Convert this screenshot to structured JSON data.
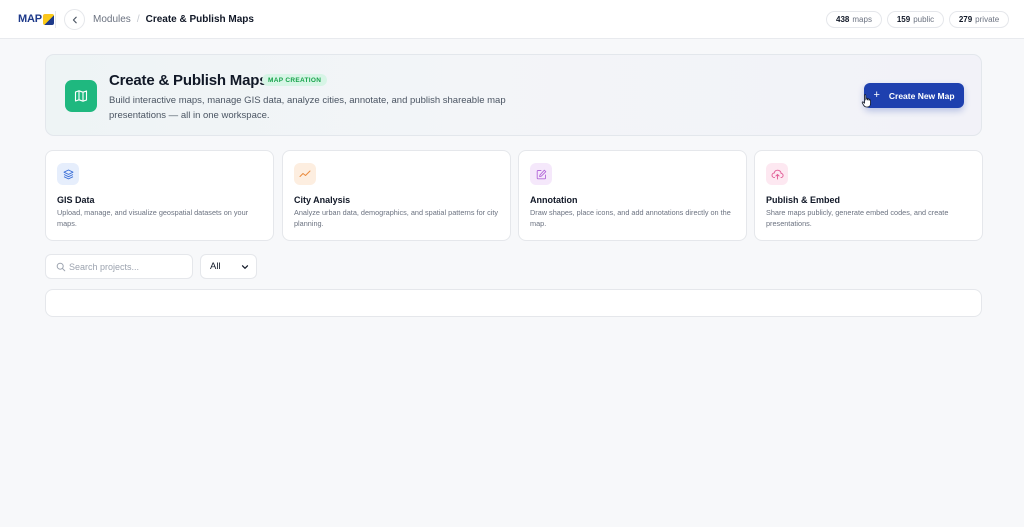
{
  "header": {
    "logo_text": "MAP",
    "breadcrumb": {
      "parent": "Modules",
      "separator": "/",
      "current": "Create & Publish Maps"
    },
    "stats": [
      {
        "value": "438",
        "label": "maps"
      },
      {
        "value": "159",
        "label": "public"
      },
      {
        "value": "279",
        "label": "private"
      }
    ]
  },
  "hero": {
    "title": "Create & Publish Maps",
    "badge": "MAP CREATION",
    "description": "Build interactive maps, manage GIS data, analyze cities, annotate, and publish shareable map presentations — all in one workspace.",
    "create_button": {
      "icon": "+",
      "label": "Create New Map"
    }
  },
  "features": [
    {
      "icon": "layers-icon",
      "title": "GIS Data",
      "description": "Upload, manage, and visualize geospatial datasets on your maps.",
      "icon_bg": "#e6eefc",
      "icon_color": "#3b6fd8"
    },
    {
      "icon": "trend-line-icon",
      "title": "City Analysis",
      "description": "Analyze urban data, demographics, and spatial patterns for city planning.",
      "icon_bg": "#fdeee0",
      "icon_color": "#ea8a3c"
    },
    {
      "icon": "edit-square-icon",
      "title": "Annotation",
      "description": "Draw shapes, place icons, and add annotations directly on the map.",
      "icon_bg": "#f5e8fb",
      "icon_color": "#b368d9"
    },
    {
      "icon": "cloud-upload-icon",
      "title": "Publish & Embed",
      "description": "Share maps publicly, generate embed codes, and create presentations.",
      "icon_bg": "#fde8f1",
      "icon_color": "#e05a95"
    }
  ],
  "toolbar": {
    "search_placeholder": "Search projects...",
    "filter_selected": "All"
  },
  "colors": {
    "accent": "#1e40af",
    "success": "#1fb87f",
    "badge_bg": "#d7f5e6",
    "badge_text": "#16a34a"
  }
}
